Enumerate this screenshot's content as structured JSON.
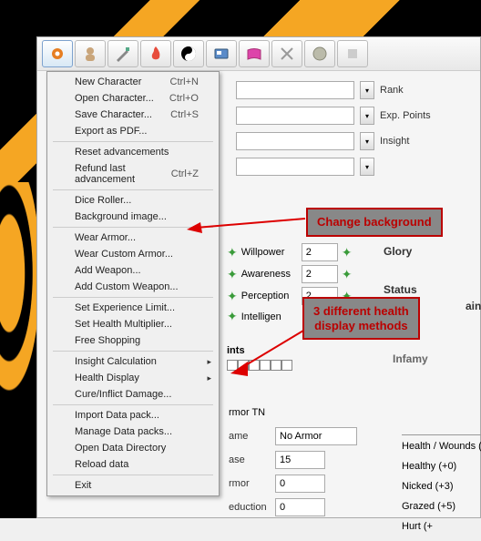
{
  "toolbar": {
    "icons": [
      "gear-icon",
      "character-icon",
      "swords-icon",
      "flame-icon",
      "yinyang-icon",
      "card-icon",
      "book-icon",
      "crossed-icon",
      "coin-icon",
      "misc-icon"
    ]
  },
  "menu": {
    "groups": [
      [
        {
          "label": "New Character",
          "shortcut": "Ctrl+N"
        },
        {
          "label": "Open Character...",
          "shortcut": "Ctrl+O"
        },
        {
          "label": "Save Character...",
          "shortcut": "Ctrl+S"
        },
        {
          "label": "Export as PDF..."
        }
      ],
      [
        {
          "label": "Reset advancements"
        },
        {
          "label": "Refund last advancement",
          "shortcut": "Ctrl+Z"
        }
      ],
      [
        {
          "label": "Dice Roller..."
        },
        {
          "label": "Background image..."
        }
      ],
      [
        {
          "label": "Wear Armor..."
        },
        {
          "label": "Wear Custom Armor..."
        },
        {
          "label": "Add Weapon..."
        },
        {
          "label": "Add Custom Weapon..."
        }
      ],
      [
        {
          "label": "Set Experience Limit..."
        },
        {
          "label": "Set Health Multiplier..."
        },
        {
          "label": "Free Shopping"
        }
      ],
      [
        {
          "label": "Insight Calculation",
          "submenu": true
        },
        {
          "label": "Health Display",
          "submenu": true
        },
        {
          "label": "Cure/Inflict Damage..."
        }
      ],
      [
        {
          "label": "Import Data pack..."
        },
        {
          "label": "Manage Data packs..."
        },
        {
          "label": "Open Data Directory"
        },
        {
          "label": "Reload data"
        }
      ],
      [
        {
          "label": "Exit"
        }
      ]
    ]
  },
  "right_labels": {
    "rank": "Rank",
    "exp": "Exp. Points",
    "insight": "Insight"
  },
  "stats": [
    {
      "name": "Willpower",
      "val": "2"
    },
    {
      "name": "Awareness",
      "val": "2"
    },
    {
      "name": "Perception",
      "val": "2"
    },
    {
      "name": "Intelligen",
      "val": ""
    }
  ],
  "sections": {
    "glory": "Glory",
    "status": "Status",
    "taint": "aint",
    "infamy": "Infamy",
    "points": "ints"
  },
  "armor": {
    "tn_label": "rmor TN",
    "name_label": "ame",
    "name_val": "No Armor",
    "base_label": "ase",
    "base_val": "15",
    "armor_label": "rmor",
    "armor_val": "0",
    "red_label": "eduction",
    "red_val": "0"
  },
  "hw": {
    "title": "Health / Wounds (x",
    "rows": [
      "Healthy (+0)",
      "Nicked (+3)",
      "Grazed (+5)",
      "Hurt (+"
    ]
  },
  "annotations": {
    "a1": "Change background",
    "a2": "3 different health\ndisplay methods"
  }
}
